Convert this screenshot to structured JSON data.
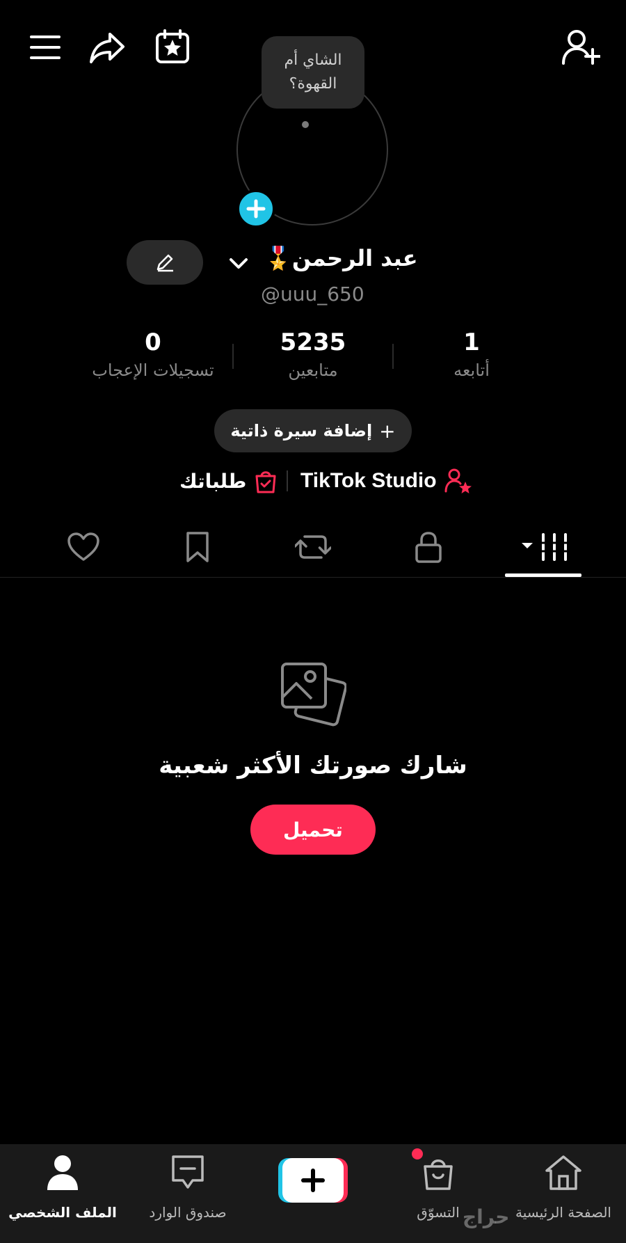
{
  "header": {
    "menu_icon": "menu-icon",
    "share_icon": "share-icon",
    "calendar_icon": "calendar-star-icon",
    "add_friend_icon": "add-user-icon"
  },
  "profile": {
    "note_bubble": [
      "الشاي أم",
      "القهوة؟"
    ],
    "name": "عبد الرحمن🎖️",
    "username": "@uuu_650",
    "add_photo_icon": "plus-icon",
    "edit_icon": "pencil-icon"
  },
  "stats": [
    {
      "value": "0",
      "label": "تسجيلات الإعجاب"
    },
    {
      "value": "5235",
      "label": "متابعين"
    },
    {
      "value": "1",
      "label": "أتابعه"
    }
  ],
  "bio_button": {
    "label": "إضافة سيرة ذاتية",
    "icon": "+"
  },
  "links": {
    "studio_label": "TikTok Studio",
    "orders_label": "طلباتك"
  },
  "tabs": [
    "heart-icon",
    "bookmark-icon",
    "repost-icon",
    "lock-icon",
    "grid-icon"
  ],
  "empty_state": {
    "title": "شارك صورتك الأكثر شعبية",
    "upload_label": "تحميل",
    "icon": "photos-icon"
  },
  "bottom_nav": {
    "profile": "الملف الشخصي",
    "inbox": "صندوق الوارد",
    "shop": "التسوّق",
    "home": "الصفحة الرئيسية"
  },
  "colors": {
    "accent": "#fe2c55",
    "cyan": "#20c4e6",
    "background": "#000000"
  },
  "watermark": "حراج"
}
